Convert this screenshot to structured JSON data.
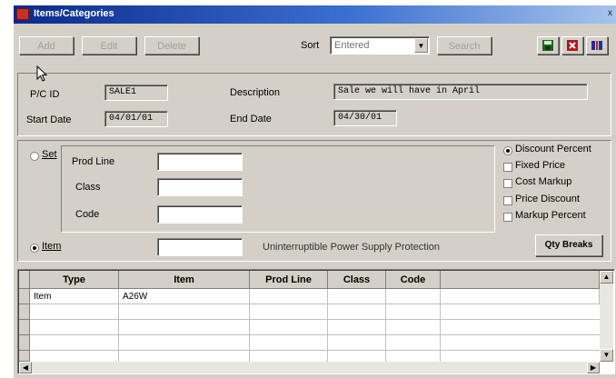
{
  "window": {
    "title": "Items/Categories",
    "close_glyph": "x"
  },
  "toolbar": {
    "add_label": "Add",
    "edit_label": "Edit",
    "delete_label": "Delete",
    "sort_label": "Sort",
    "sort_value": "Entered",
    "search_label": "Search",
    "icons": [
      "save-icon",
      "cancel-icon",
      "sort-icon"
    ]
  },
  "header": {
    "pc_id_label": "P/C ID",
    "pc_id_value": "SALE1",
    "description_label": "Description",
    "description_value": "Sale we will have in April",
    "start_date_label": "Start Date",
    "start_date_value": "04/01/01",
    "end_date_label": "End Date",
    "end_date_value": "04/30/01"
  },
  "selection": {
    "set_label": "Set",
    "prod_line_label": "Prod Line",
    "class_label": "Class",
    "code_label": "Code",
    "item_label": "Item",
    "item_value": "",
    "item_description": "Uninterruptible Power Supply Protection",
    "selected": "item"
  },
  "pricing": {
    "discount_percent": "Discount Percent",
    "fixed_price": "Fixed Price",
    "cost_markup": "Cost Markup",
    "price_discount": "Price Discount",
    "markup_percent": "Markup Percent",
    "selected": "discount_percent",
    "qty_breaks_label": "Qty Breaks"
  },
  "grid": {
    "columns": [
      "Type",
      "Item",
      "Prod Line",
      "Class",
      "Code"
    ],
    "rows": [
      [
        "Item",
        "A26W",
        "",
        "",
        ""
      ]
    ]
  }
}
